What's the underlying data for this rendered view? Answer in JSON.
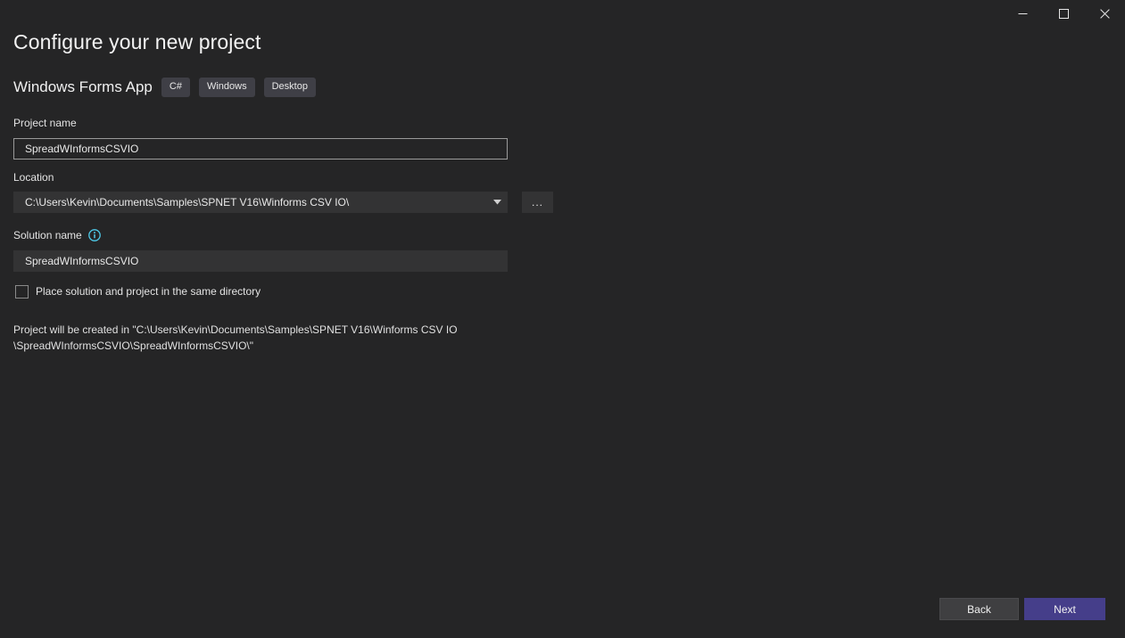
{
  "window": {
    "controls": [
      {
        "name": "minimize",
        "label": "Minimize",
        "glyph": "minimize-icon"
      },
      {
        "name": "maximize",
        "label": "Maximize",
        "glyph": "maximize-icon"
      },
      {
        "name": "close",
        "label": "Close",
        "glyph": "close-icon"
      }
    ]
  },
  "header": {
    "title": "Configure your new project",
    "template_name": "Windows Forms App",
    "tags": [
      "C#",
      "Windows",
      "Desktop"
    ]
  },
  "form": {
    "project_name": {
      "label": "Project name",
      "value": "SpreadWInformsCSVIO",
      "placeholder": ""
    },
    "location": {
      "label": "Location",
      "value": "C:\\Users\\Kevin\\Documents\\Samples\\SPNET V16\\Winforms CSV IO\\",
      "placeholder": "",
      "dropdown_icon": "chevron-down-icon",
      "browse_label": "..."
    },
    "solution_name": {
      "label": "Solution name",
      "info_icon": "info-icon",
      "value": "SpreadWInformsCSVIO",
      "placeholder": ""
    },
    "same_directory": {
      "label": "Place solution and project in the same directory",
      "checked": false
    },
    "created_in": "Project will be created in \"C:\\Users\\Kevin\\Documents\\Samples\\SPNET V16\\Winforms CSV IO\n\\SpreadWInformsCSVIO\\SpreadWInformsCSVIO\\\""
  },
  "footer": {
    "back_label": "Back",
    "next_label": "Next"
  },
  "colors": {
    "background": "#252526",
    "field_background": "#333334",
    "accent_primary": "#453e8a",
    "tag_background": "#3f3f46",
    "info_icon": "#4ec9e8",
    "text": "#f0f0f0"
  }
}
